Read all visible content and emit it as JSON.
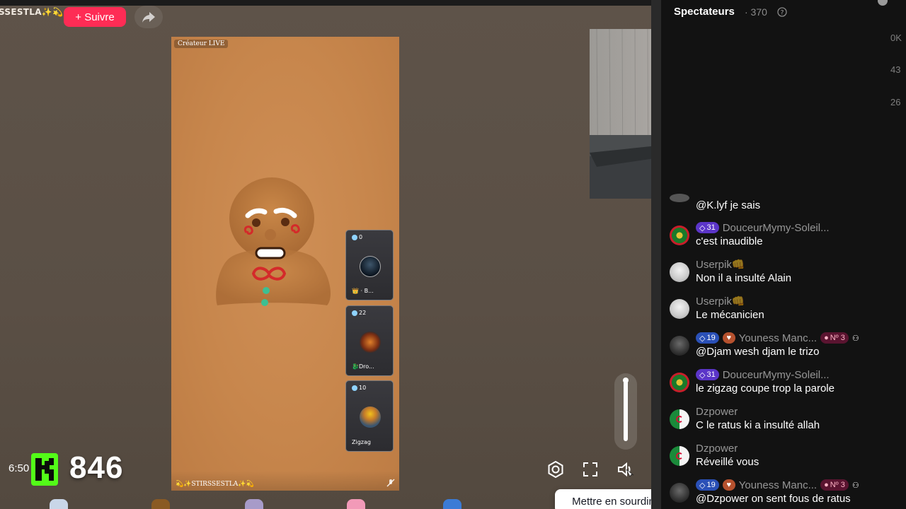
{
  "stream": {
    "creator_name": "SSESTLA✨💫",
    "follow_label": "+ Suivre",
    "live_tag": "Créateur LIVE",
    "host_label": "💫✨STIRSSESTLA✨💫"
  },
  "guests": [
    {
      "score": "0",
      "name": "👑 · B..."
    },
    {
      "score": "22",
      "name": "🐉Dro..."
    },
    {
      "score": "10",
      "name": "Zigzag"
    }
  ],
  "overlay": {
    "time": "6:50",
    "k_count": "846"
  },
  "controls": {
    "volume_level": 1.0,
    "tooltip": "Mettre en sourdine (M)"
  },
  "chat": {
    "viewers_title": "Spectateurs",
    "viewers_count": "· 370",
    "right_numbers": [
      "0K",
      "43",
      "26"
    ],
    "partial_message": "@K.lyf je sais",
    "messages": [
      {
        "user": "DouceurMymy-Soleil...",
        "badge_level": "31",
        "badge_type": "purple",
        "text": "c'est inaudible",
        "avatar": "flag-portugal"
      },
      {
        "user": "Userpik👊",
        "text": "Non il a insulté Alain",
        "avatar": "sketch"
      },
      {
        "user": "Userpik👊",
        "text": "Le mécanicien",
        "avatar": "sketch"
      },
      {
        "user": "Youness Manc...",
        "badge_level": "19",
        "badge_type": "blue",
        "rank": "Nº 3",
        "text": "@Djam wesh djam le trizo",
        "avatar": "dark"
      },
      {
        "user": "DouceurMymy-Soleil...",
        "badge_level": "31",
        "badge_type": "purple",
        "text": "le zigzag coupe trop la parole",
        "avatar": "flag-portugal"
      },
      {
        "user": "Dzpower",
        "text": "C le ratus ki a insulté allah",
        "avatar": "flag-algeria"
      },
      {
        "user": "Dzpower",
        "text": "Réveillé vous",
        "avatar": "flag-algeria"
      },
      {
        "user": "Youness Manc...",
        "badge_level": "19",
        "badge_type": "blue",
        "rank": "Nº 3",
        "text": "@Dzpower on sent fous de ratus",
        "avatar": "dark"
      }
    ]
  },
  "colors": {
    "follow": "#fe2c55",
    "kick_green": "#53fc18",
    "chat_bg": "#121212",
    "video_bg": "#c7864c"
  }
}
